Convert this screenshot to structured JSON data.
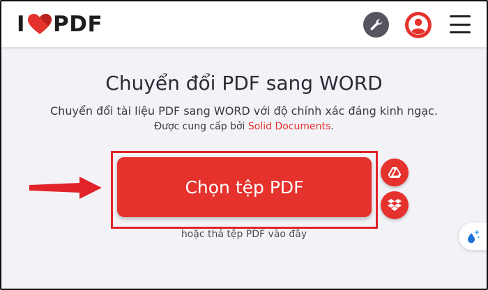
{
  "header": {
    "logo": {
      "prefix": "I",
      "suffix": "PDF",
      "heart_color": "#e5322d"
    },
    "icons": {
      "tools": "wrench-icon",
      "account": "user-account-icon",
      "menu": "hamburger-menu-icon"
    }
  },
  "main": {
    "title": "Chuyển đổi PDF sang WORD",
    "description": "Chuyển đổi tài liệu PDF sang WORD với độ chính xác đáng kinh ngạc.",
    "provider_prefix": "Được cung cấp bởi ",
    "provider_link": "Solid Documents",
    "provider_suffix": ".",
    "select_button": "Chọn tệp PDF",
    "drop_hint": "hoặc thả tệp PDF vào đây",
    "side_buttons": [
      "google-drive-icon",
      "dropbox-icon"
    ]
  },
  "colors": {
    "accent": "#e5322d",
    "text": "#2b2b36",
    "background": "#f3f2f7",
    "annotation_red": "#e0242a"
  }
}
